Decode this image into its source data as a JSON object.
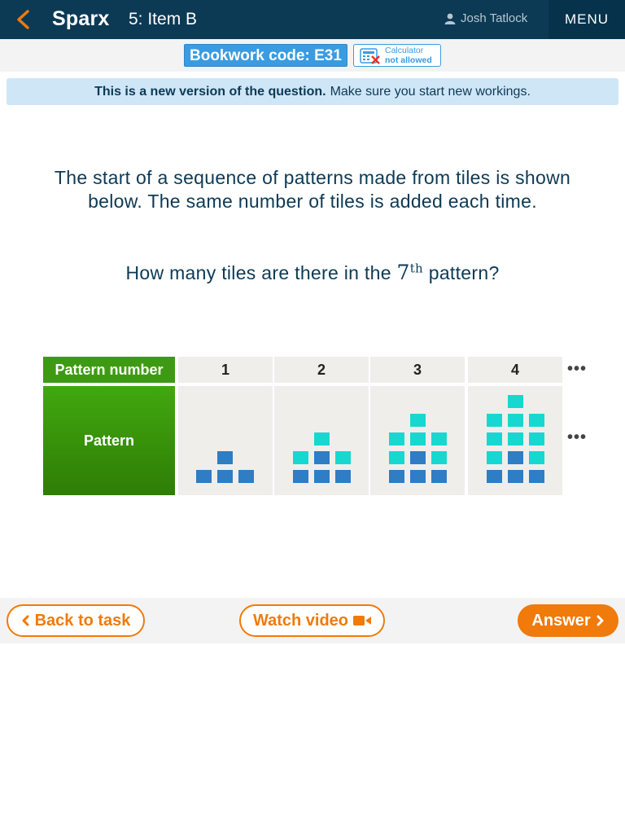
{
  "header": {
    "brand": "Sparx",
    "item_title": "5: Item B",
    "user_name": "Josh Tatlock",
    "menu_label": "MENU"
  },
  "codebar": {
    "bookwork_code": "Bookwork code: E31",
    "calculator_line1": "Calculator",
    "calculator_line2": "not allowed"
  },
  "notice": {
    "bold": "This is a new version of the question.",
    "text": "Make sure you start new workings."
  },
  "question": {
    "line1": "The start of a sequence of patterns made from tiles is shown below. The same number of tiles is added each time.",
    "line2_pre": "How many tiles are there in the",
    "line2_num": "7",
    "line2_sup": "th",
    "line2_post": "pattern?"
  },
  "table": {
    "header_label": "Pattern number",
    "row_label": "Pattern",
    "pattern_numbers": [
      "1",
      "2",
      "3",
      "4"
    ],
    "continuation": "•••"
  },
  "footer": {
    "back_label": "Back to task",
    "video_label": "Watch video",
    "answer_label": "Answer"
  },
  "colors": {
    "header_bg": "#0c3a55",
    "accent_orange": "#f07a0a",
    "bookwork_blue": "#3a9be0",
    "table_green": "#3e9a12",
    "tile_dark": "#2e7dc5",
    "tile_light": "#17d8d0"
  },
  "icons": {
    "back": "chevron-left-icon",
    "user": "user-icon",
    "calculator": "calculator-crossed-icon",
    "video": "video-camera-icon",
    "next": "chevron-right-icon"
  }
}
